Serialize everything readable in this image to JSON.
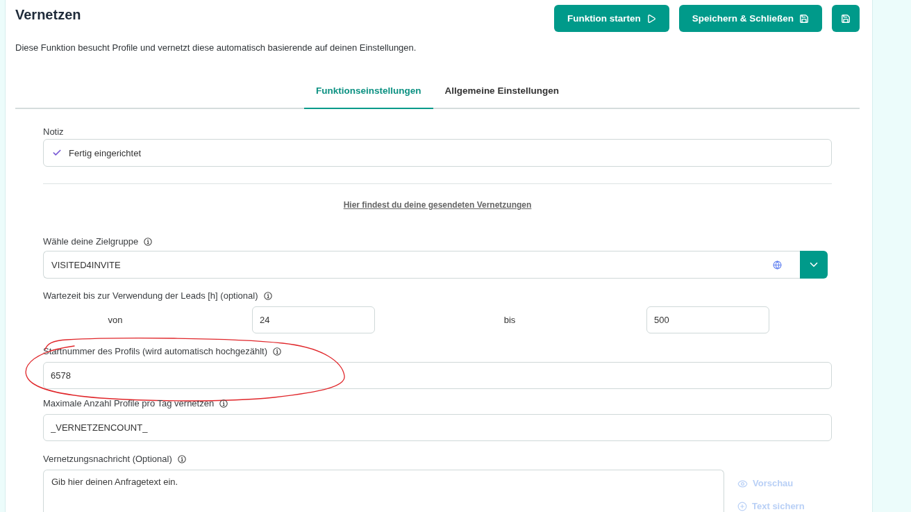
{
  "header": {
    "title": "Vernetzen",
    "buttons": [
      {
        "kind": "run",
        "label": "Funktion starten"
      },
      {
        "kind": "save_close",
        "label": "Speichern & Schließen"
      },
      {
        "kind": "save"
      }
    ]
  },
  "description": "Diese Funktion besucht Profile und vernetzt diese automatisch basierende auf deinen Einstellungen.",
  "tabs": [
    {
      "label": "Funktionseinstellungen",
      "selected": true
    },
    {
      "label": "Allgemeine Einstellungen",
      "selected": false
    }
  ],
  "note": {
    "label": "Notiz",
    "value": "Fertig eingerichtet"
  },
  "link": "Hier findest du deine gesendeten Vernetzungen",
  "fields": [
    {
      "kind": "select",
      "label": "Wähle deine Zielgruppe",
      "info": true,
      "value": "VISITED4INVITE"
    },
    {
      "kind": "range",
      "label": "Wartezeit bis zur Verwendung der Leads [h] (optional)",
      "info": true,
      "from": {
        "label": "von",
        "value": "24"
      },
      "to": {
        "label": "bis",
        "value": "500"
      }
    },
    {
      "kind": "text",
      "label": "Startnummer des Profils (wird automatisch hochgezählt)",
      "info": true,
      "value": "6578",
      "annotated": true
    },
    {
      "kind": "text",
      "label": "Maximale Anzahl Profile pro Tag vernetzen",
      "info": true,
      "value": "_VERNETZENCOUNT_"
    },
    {
      "kind": "textarea",
      "label": "Vernetzungsnachricht (Optional)",
      "info": true,
      "placeholder": "Gib hier deinen Anfragetext ein.",
      "actions": [
        {
          "kind": "preview",
          "label": "Vorschau",
          "disabled": true
        },
        {
          "kind": "save_text",
          "label": "Text sichern",
          "disabled": true
        }
      ]
    }
  ]
}
